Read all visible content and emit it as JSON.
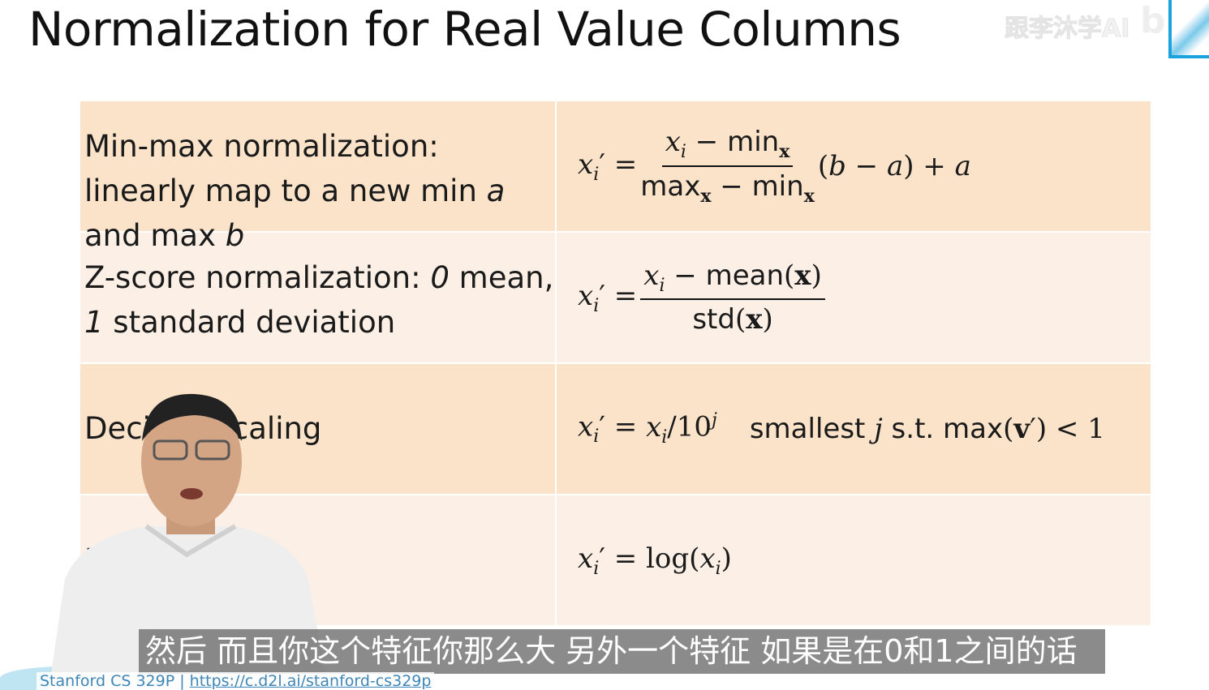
{
  "slide": {
    "title": "Normalization for Real Value Columns",
    "rows": [
      {
        "desc_a": "Min-max normalization: linearly map to a new min ",
        "desc_b": "a",
        "desc_c": " and max ",
        "desc_d": "b"
      },
      {
        "desc_a": "Z-score normalization: ",
        "desc_b": "0",
        "desc_c": " mean, ",
        "desc_d": "1",
        "desc_e": " standard deviation"
      },
      {
        "desc": "Decimal scaling",
        "formula_note": "smallest"
      },
      {
        "desc": "Log scaling"
      }
    ],
    "footer": {
      "prefix": "Stanford CS 329P | ",
      "link": "https://c.d2l.ai/stanford-cs329p"
    }
  },
  "watermark": {
    "text": "跟李沐学AI",
    "logo": "bili"
  },
  "subtitle": "然后 而且你这个特征你那么大 另外一个特征 如果是在0和1之间的话",
  "colors": {
    "row_odd": "#fae3c9",
    "row_even": "#fcefe5",
    "subtitle_bg": "#6e6e6e",
    "logo_blue": "#1aa3dd"
  }
}
